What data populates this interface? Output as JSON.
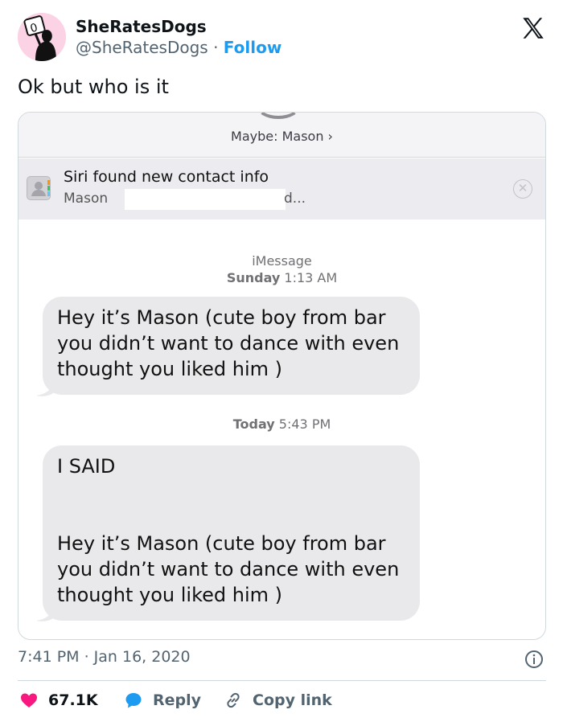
{
  "user": {
    "display_name": "SheRatesDogs",
    "handle": "@SheRatesDogs",
    "separator": "·",
    "follow_label": "Follow",
    "avatar_icon": "avatar-woman-holding-sign-icon",
    "platform_icon": "x-logo-icon"
  },
  "tweet": {
    "text": "Ok but who is it",
    "timestamp": "7:41 PM · Jan 16, 2020"
  },
  "screenshot": {
    "maybe_label": "Maybe: Mason ›",
    "siri_title": "Siri found new contact info",
    "siri_name": "Mason",
    "siri_trailing": "d...",
    "service": "iMessage",
    "time1_day": "Sunday",
    "time1_clock": "1:13 AM",
    "time2_day": "Today",
    "time2_clock": "5:43 PM",
    "message1": "Hey it’s Mason (cute boy from bar you didn’t want to dance with even thought you liked him )",
    "message2_line1": "I SAID",
    "message2_body": "Hey it’s Mason (cute boy from bar you didn’t want to dance with even thought you liked him )"
  },
  "actions": {
    "likes": "67.1K",
    "reply": "Reply",
    "copy_link": "Copy link"
  },
  "colors": {
    "accent": "#1d9bf0",
    "like": "#f91880",
    "bubble": "#e9e9eb"
  }
}
